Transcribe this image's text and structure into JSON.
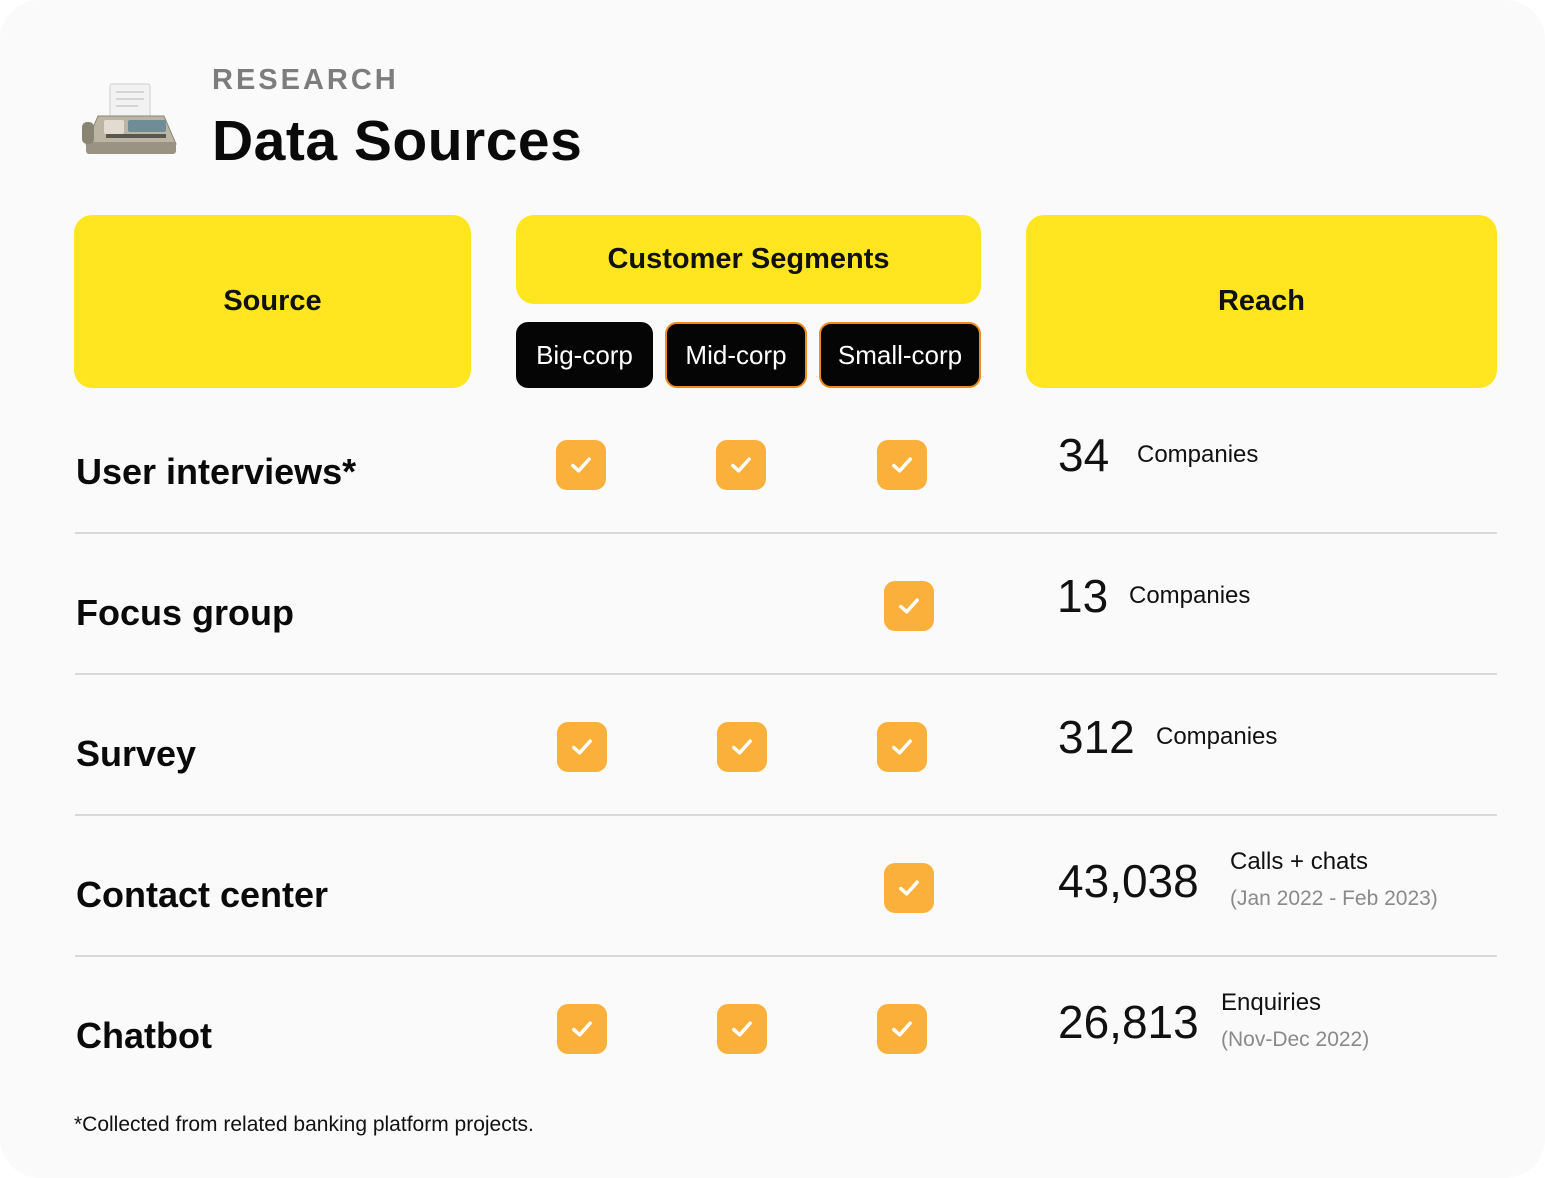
{
  "header": {
    "eyebrow": "RESEARCH",
    "title": "Data Sources",
    "icon": "fax-machine-icon"
  },
  "columns": {
    "source": "Source",
    "segments": "Customer Segments",
    "reach": "Reach",
    "segment_chips": [
      "Big-corp",
      "Mid-corp",
      "Small-corp"
    ]
  },
  "colors": {
    "header_yellow": "#ffe620",
    "check_orange": "#fbb03b",
    "chip_black": "#050505",
    "chip_border_orange": "#ee8a22"
  },
  "rows": [
    {
      "label": "User interviews*",
      "big_corp": true,
      "mid_corp": true,
      "small_corp": true,
      "reach_value": "34",
      "reach_unit": "Companies",
      "reach_note": ""
    },
    {
      "label": "Focus group",
      "big_corp": false,
      "mid_corp": false,
      "small_corp": true,
      "reach_value": "13",
      "reach_unit": "Companies",
      "reach_note": ""
    },
    {
      "label": "Survey",
      "big_corp": true,
      "mid_corp": true,
      "small_corp": true,
      "reach_value": "312",
      "reach_unit": "Companies",
      "reach_note": ""
    },
    {
      "label": "Contact center",
      "big_corp": false,
      "mid_corp": false,
      "small_corp": true,
      "reach_value": "43,038",
      "reach_unit": "Calls + chats",
      "reach_note": "(Jan 2022 - Feb 2023)"
    },
    {
      "label": "Chatbot",
      "big_corp": true,
      "mid_corp": true,
      "small_corp": true,
      "reach_value": "26,813",
      "reach_unit": "Enquiries",
      "reach_note": "(Nov-Dec 2022)"
    }
  ],
  "footnote": "*Collected from related banking platform projects."
}
